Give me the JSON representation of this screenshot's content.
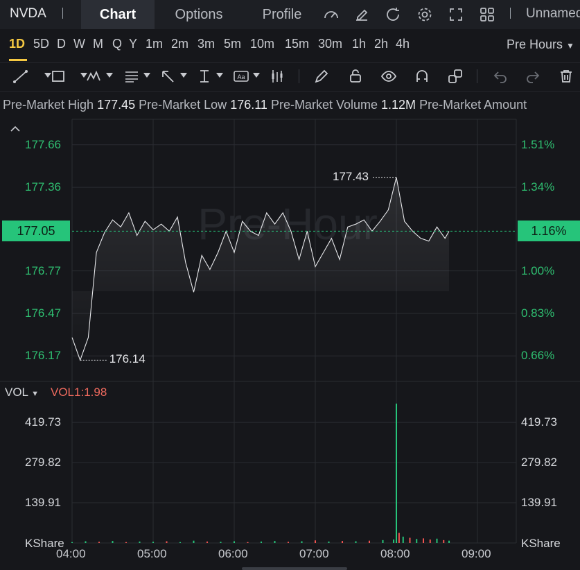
{
  "topbar": {
    "ticker": "NVDA",
    "tabs": [
      "Chart",
      "Options",
      "Profile"
    ],
    "active_tab": "Chart",
    "layout_name": "Unnamed"
  },
  "timeframes": [
    "1D",
    "5D",
    "D",
    "W",
    "M",
    "Q",
    "Y",
    "1m",
    "2m",
    "3m",
    "5m",
    "10m",
    "15m",
    "30m",
    "1h",
    "2h",
    "4h"
  ],
  "active_timeframe": "1D",
  "session_select": "Pre Hours",
  "stats": {
    "high_label": "Pre-Market High",
    "high_value": "177.45",
    "low_label": "Pre-Market Low",
    "low_value": "176.11",
    "volume_label": "Pre-Market Volume",
    "volume_value": "1.12M",
    "amount_label": "Pre-Market Amount"
  },
  "watermark": "Pre-Hour",
  "volume_panel": {
    "label": "VOL",
    "indicator": "VOL1:1.98",
    "unit": "KShare"
  },
  "colors": {
    "up": "#26c47a",
    "down": "#ef5350",
    "line": "#e8e9ec",
    "accent": "#f5c842"
  },
  "chart_data": [
    {
      "type": "line",
      "title": "",
      "x_ticks": [
        "04:00",
        "05:00",
        "06:00",
        "07:00",
        "08:00",
        "09:00"
      ],
      "y_ticks_left": [
        "177.66",
        "177.36",
        "177.05",
        "176.77",
        "176.47",
        "176.17"
      ],
      "y_ticks_right": [
        "1.51%",
        "1.34%",
        "1.16%",
        "1.00%",
        "0.83%",
        "0.66%"
      ],
      "ylim": [
        176.0,
        177.84
      ],
      "current_price": "177.05",
      "current_change": "1.16%",
      "high_annotation": "177.43",
      "low_annotation": "176.14",
      "x": [
        "04:00",
        "04:06",
        "04:12",
        "04:18",
        "04:24",
        "04:30",
        "04:36",
        "04:42",
        "04:48",
        "04:54",
        "05:00",
        "05:06",
        "05:12",
        "05:18",
        "05:24",
        "05:30",
        "05:36",
        "05:42",
        "05:48",
        "05:54",
        "06:00",
        "06:06",
        "06:12",
        "06:18",
        "06:24",
        "06:30",
        "06:36",
        "06:42",
        "06:48",
        "06:54",
        "07:00",
        "07:06",
        "07:12",
        "07:18",
        "07:24",
        "07:30",
        "07:36",
        "07:42",
        "07:48",
        "07:54",
        "08:00",
        "08:06",
        "08:12",
        "08:18",
        "08:24",
        "08:30",
        "08:36",
        "08:39"
      ],
      "values": [
        176.3,
        176.14,
        176.3,
        176.9,
        177.04,
        177.13,
        177.08,
        177.18,
        177.02,
        177.12,
        177.06,
        177.1,
        177.05,
        177.15,
        176.83,
        176.62,
        176.88,
        176.78,
        176.9,
        177.05,
        176.9,
        177.12,
        177.05,
        177.02,
        177.18,
        177.1,
        177.18,
        177.05,
        176.85,
        177.05,
        176.8,
        176.9,
        177.0,
        176.85,
        177.08,
        177.1,
        177.13,
        177.05,
        177.12,
        177.2,
        177.43,
        177.12,
        177.05,
        177.0,
        176.98,
        177.08,
        177.0,
        177.05
      ]
    },
    {
      "type": "bar",
      "title": "",
      "ylabel": "KShare",
      "y_ticks": [
        "419.73",
        "279.82",
        "139.91"
      ],
      "ylim": [
        0,
        490
      ],
      "x": [
        "04:00",
        "04:10",
        "04:20",
        "04:30",
        "04:40",
        "04:50",
        "05:00",
        "05:10",
        "05:20",
        "05:30",
        "05:40",
        "05:50",
        "06:00",
        "06:10",
        "06:20",
        "06:30",
        "06:40",
        "06:50",
        "07:00",
        "07:10",
        "07:20",
        "07:30",
        "07:40",
        "07:50",
        "07:58",
        "08:00",
        "08:02",
        "08:05",
        "08:10",
        "08:15",
        "08:20",
        "08:25",
        "08:30",
        "08:35",
        "08:39"
      ],
      "values": [
        3,
        6,
        4,
        7,
        3,
        5,
        4,
        6,
        3,
        8,
        5,
        4,
        6,
        3,
        5,
        7,
        4,
        6,
        9,
        5,
        7,
        6,
        8,
        10,
        12,
        485,
        35,
        22,
        18,
        14,
        16,
        12,
        15,
        10,
        8
      ],
      "up": [
        true,
        true,
        false,
        true,
        false,
        true,
        true,
        false,
        true,
        true,
        false,
        true,
        true,
        false,
        true,
        true,
        false,
        true,
        false,
        true,
        false,
        true,
        false,
        true,
        true,
        true,
        false,
        true,
        false,
        true,
        false,
        false,
        true,
        false,
        true
      ]
    }
  ]
}
